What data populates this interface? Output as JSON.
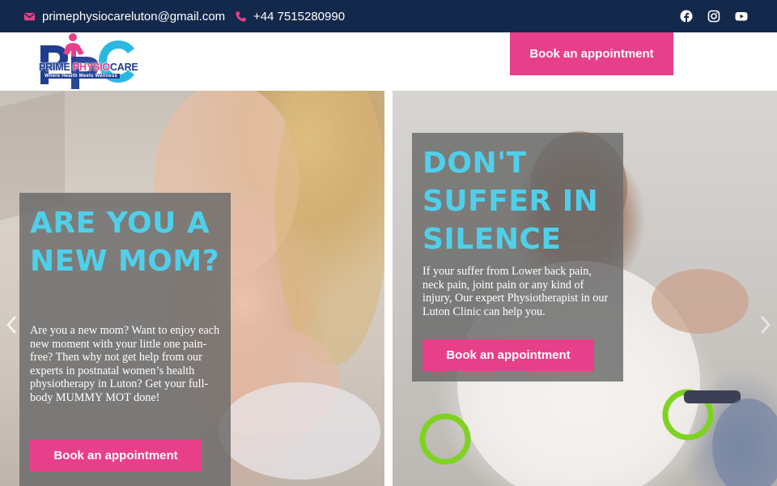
{
  "topbar": {
    "email": "primephysiocareluton@gmail.com",
    "phone": "+44 7515280990",
    "icons": [
      "envelope-icon",
      "phone-icon",
      "facebook-icon",
      "instagram-icon",
      "youtube-icon"
    ]
  },
  "header": {
    "logo_prime": "PRIME",
    "logo_physio": "PHYSIO",
    "logo_care": "CARE",
    "logo_tagline": "Where Health Meets Wellness",
    "cta_label": "Book an appointment"
  },
  "slides": [
    {
      "title": "ARE YOU A NEW MOM?",
      "text": "Are you a new mom? Want to enjoy each new moment with your little one pain-free? Then why not get help from our experts in postnatal women’s health physiotherapy in Luton? Get your full-body MUMMY MOT done!",
      "button_label": "Book an appointment"
    },
    {
      "title": "DON'T SUFFER IN SILENCE",
      "text": "If your suffer from Lower back pain, neck pain, joint pain or any kind of injury, Our expert Physiotherapist in our Luton Clinic can help you.",
      "button_label": "Book an appointment"
    }
  ],
  "colors": {
    "topbar_bg": "#13294b",
    "accent_pink": "#e83f8a",
    "title_cyan": "#4fd0ea",
    "brand_blue": "#1f3d8f"
  }
}
